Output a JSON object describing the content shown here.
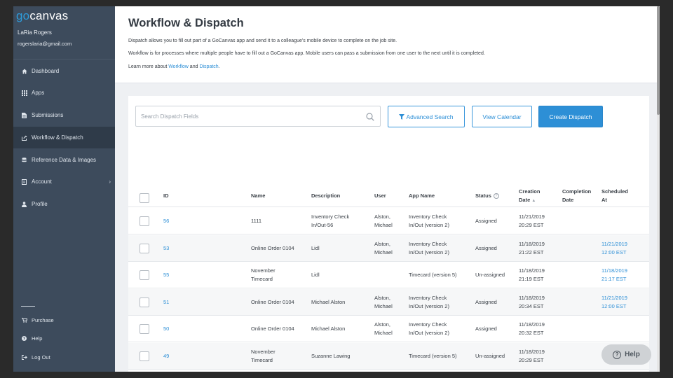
{
  "sidebar": {
    "logo": {
      "go": "go",
      "rest": "canvas"
    },
    "user": {
      "name": "LaRia Rogers",
      "email": "rogerslaria@gmail.com"
    },
    "nav": [
      {
        "label": "Dashboard",
        "icon": "home-icon"
      },
      {
        "label": "Apps",
        "icon": "grid-icon"
      },
      {
        "label": "Submissions",
        "icon": "document-icon"
      },
      {
        "label": "Workflow & Dispatch",
        "icon": "share-icon",
        "active": true
      },
      {
        "label": "Reference Data & Images",
        "icon": "database-icon"
      },
      {
        "label": "Account",
        "icon": "account-icon",
        "has_chevron": true
      },
      {
        "label": "Profile",
        "icon": "person-icon"
      }
    ],
    "bottom": [
      {
        "label": "Purchase",
        "icon": "cart-icon"
      },
      {
        "label": "Help",
        "icon": "question-icon"
      },
      {
        "label": "Log Out",
        "icon": "logout-icon"
      }
    ]
  },
  "header": {
    "title": "Workflow & Dispatch",
    "line1": "Dispatch allows you to fill out part of a GoCanvas app and send it to a colleague's mobile device to complete on the job site.",
    "line2": "Workflow is for processes where multiple people have to fill out a GoCanvas app. Mobile users can pass a submission from one user to the next until it is completed.",
    "learn_prefix": "Learn more about ",
    "workflow_link": "Workflow",
    "and_text": " and ",
    "dispatch_link": "Dispatch",
    "period": "."
  },
  "toolbar": {
    "search_placeholder": "Search Dispatch Fields",
    "advanced_search": "Advanced Search",
    "view_calendar": "View Calendar",
    "create_dispatch": "Create Dispatch"
  },
  "table": {
    "headers": {
      "id": "ID",
      "name": "Name",
      "description": "Description",
      "user": "User",
      "app_name": "App Name",
      "status": "Status",
      "creation_date_1": "Creation",
      "creation_date_2": "Date",
      "sort_indicator": "▲",
      "completion_date_1": "Completion",
      "completion_date_2": "Date",
      "scheduled_at_1": "Scheduled",
      "scheduled_at_2": "At"
    },
    "rows": [
      {
        "id": "56",
        "name": [
          "1111"
        ],
        "description": [
          "Inventory Check",
          "In/Out-56"
        ],
        "user": [
          "Alston,",
          "Michael"
        ],
        "app": [
          "Inventory Check",
          "In/Out (version 2)"
        ],
        "status": "Assigned",
        "created": [
          "11/21/2019",
          "20:29 EST"
        ],
        "completed": [],
        "scheduled": []
      },
      {
        "id": "53",
        "name": [
          "Online Order 0104"
        ],
        "description": [
          "Lidl"
        ],
        "user": [
          "Alston,",
          "Michael"
        ],
        "app": [
          "Inventory Check",
          "In/Out (version 2)"
        ],
        "status": "Assigned",
        "created": [
          "11/18/2019",
          "21:22 EST"
        ],
        "completed": [],
        "scheduled": [
          "11/21/2019",
          "12:00 EST"
        ]
      },
      {
        "id": "55",
        "name": [
          "November",
          "Timecard"
        ],
        "description": [
          "Lidl"
        ],
        "user": [],
        "app": [
          "Timecard (version 5)"
        ],
        "status": "Un-assigned",
        "created": [
          "11/18/2019",
          "21:19 EST"
        ],
        "completed": [],
        "scheduled": [
          "11/18/2019",
          "21:17 EST"
        ]
      },
      {
        "id": "51",
        "name": [
          "Online Order 0104"
        ],
        "description": [
          "Michael Alston"
        ],
        "user": [
          "Alston,",
          "Michael"
        ],
        "app": [
          "Inventory Check",
          "In/Out (version 2)"
        ],
        "status": "Assigned",
        "created": [
          "11/18/2019",
          "20:34 EST"
        ],
        "completed": [],
        "scheduled": [
          "11/21/2019",
          "12:00 EST"
        ]
      },
      {
        "id": "50",
        "name": [
          "Online Order 0104"
        ],
        "description": [
          "Michael Alston"
        ],
        "user": [
          "Alston,",
          "Michael"
        ],
        "app": [
          "Inventory Check",
          "In/Out (version 2)"
        ],
        "status": "Assigned",
        "created": [
          "11/18/2019",
          "20:32 EST"
        ],
        "completed": [],
        "scheduled": []
      },
      {
        "id": "49",
        "name": [
          "November",
          "Timecard"
        ],
        "description": [
          "Suzanne Lawing"
        ],
        "user": [],
        "app": [
          "Timecard (version 5)"
        ],
        "status": "Un-assigned",
        "created": [
          "11/18/2019",
          "20:29 EST"
        ],
        "completed": [],
        "scheduled": []
      }
    ]
  },
  "help_button": {
    "label": "Help",
    "icon": "question-circle-icon"
  },
  "colors": {
    "sidebar": "#3d4b5c",
    "sidebar_active": "#2f3b49",
    "accent": "#2d8fd6"
  }
}
